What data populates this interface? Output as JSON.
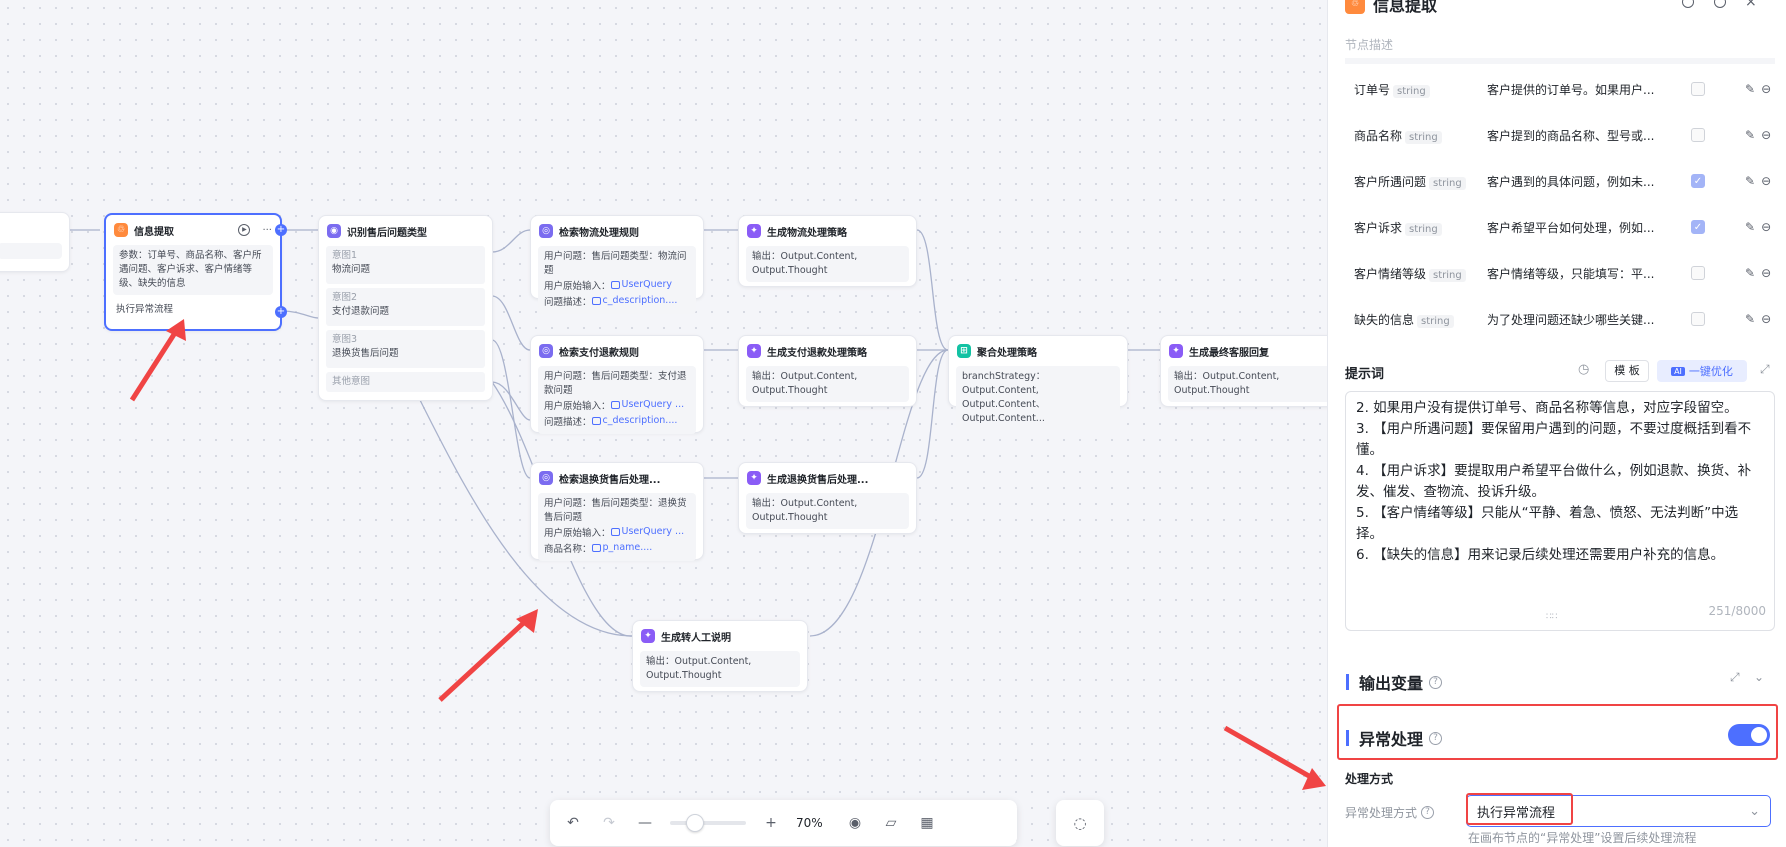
{
  "canvas": {
    "nodes": {
      "info": {
        "title": "信息提取",
        "params": "参数：订单号、商品名称、客户所遇问题、客户诉求、客户情绪等级、缺失的信息",
        "exception": "执行异常流程"
      },
      "classify": {
        "title": "识别售后问题类型",
        "intents": [
          {
            "label": "意图1",
            "text": "物流问题"
          },
          {
            "label": "意图2",
            "text": "支付退款问题"
          },
          {
            "label": "意图3",
            "text": "退换货售后问题"
          },
          {
            "label": "其他意图",
            "text": ""
          }
        ]
      },
      "kb_logistics": {
        "title": "检索物流处理规则",
        "l1": "用户问题：售后问题类型：物流问题",
        "l2k": "用户原始输入：",
        "l2v": "UserQuery",
        "l3k": "问题描述：",
        "l3v": "c_description...."
      },
      "kb_refund": {
        "title": "检索支付退款规则",
        "l1": "用户问题：售后问题类型：支付退款问题",
        "l2k": "用户原始输入：",
        "l2v": "UserQuery ...",
        "l3k": "问题描述：",
        "l3v": "c_description...."
      },
      "kb_return": {
        "title": "检索退换货售后处理...",
        "l1": "用户问题：售后问题类型：退换货售后问题",
        "l2k": "用户原始输入：",
        "l2v": "UserQuery ...",
        "l3k": "商品名称：",
        "l3v": "p_name...."
      },
      "gen_logistics": {
        "title": "生成物流处理策略",
        "out": "输出：Output.Content, Output.Thought"
      },
      "gen_refund": {
        "title": "生成支付退款处理策略",
        "out": "输出：Output.Content, Output.Thought"
      },
      "gen_return": {
        "title": "生成退换货售后处理...",
        "out": "输出：Output.Content, Output.Thought"
      },
      "gen_human": {
        "title": "生成转人工说明",
        "out": "输出：Output.Content, Output.Thought"
      },
      "aggregate": {
        "title": "聚合处理策略",
        "out": "branchStrategy：Output.Content, Output.Content、Output.Content..."
      },
      "final": {
        "title": "生成最终客服回复",
        "out": "输出：Output.Content, Output.Thought"
      }
    },
    "toolbar": {
      "zoom": "70%"
    }
  },
  "panel": {
    "title": "信息提取",
    "desc_placeholder": "节点描述",
    "params": [
      {
        "name": "订单号",
        "type": "string",
        "desc": "客户提供的订单号。如果用户...",
        "checked": false
      },
      {
        "name": "商品名称",
        "type": "string",
        "desc": "客户提到的商品名称、型号或...",
        "checked": false
      },
      {
        "name": "客户所遇问题",
        "type": "string",
        "desc": "客户遇到的具体问题，例如未...",
        "checked": true
      },
      {
        "name": "客户诉求",
        "type": "string",
        "desc": "客户希望平台如何处理，例如...",
        "checked": true
      },
      {
        "name": "客户情绪等级",
        "type": "string",
        "desc": "客户情绪等级，只能填写：平...",
        "checked": false
      },
      {
        "name": "缺失的信息",
        "type": "string",
        "desc": "为了处理问题还缺少哪些关键...",
        "checked": false
      }
    ],
    "prompt_label": "提示词",
    "template_btn": "模 板",
    "optimize_btn": "一键优化",
    "ai_badge": "AI",
    "prompt_lines": [
      "2. 如果用户没有提供订单号、商品名称等信息，对应字段留空。",
      "3. 【用户所遇问题】要保留用户遇到的问题，不要过度概括到看不懂。",
      "4. 【用户诉求】要提取用户希望平台做什么，例如退款、换货、补发、催发、查物流、投诉升级。",
      "5. 【客户情绪等级】只能从“平静、着急、愤怒、无法判断”中选择。",
      "6. 【缺失的信息】用来记录后续处理还需要用户补充的信息。"
    ],
    "prompt_count": "251/8000",
    "output_section": "输出变量",
    "exception_section": "异常处理",
    "handle_label": "处理方式",
    "handle_field_label": "异常处理方式",
    "handle_value": "执行异常流程",
    "handle_hint": "在画布节点的“异常处理”设置后续处理流程"
  },
  "colors": {
    "accent": "#4d6fff",
    "annotation": "#f04444"
  }
}
